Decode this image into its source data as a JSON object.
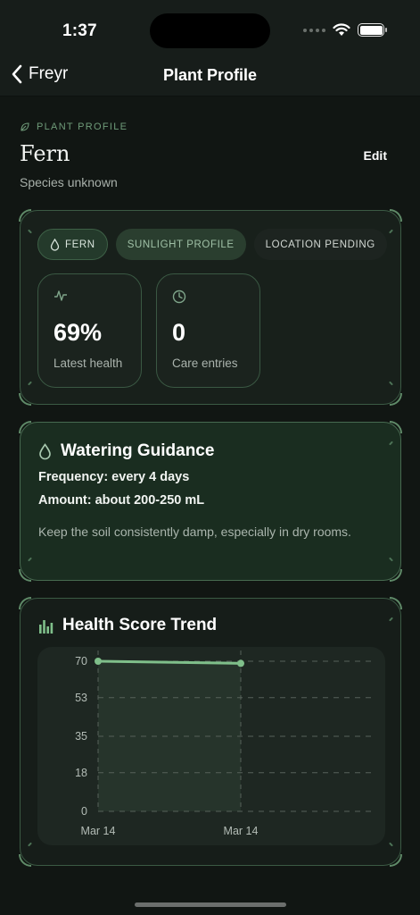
{
  "status_bar": {
    "time": "1:37"
  },
  "nav": {
    "back_label": "Freyr",
    "title": "Plant Profile"
  },
  "header": {
    "eyebrow": "PLANT PROFILE",
    "name": "Fern",
    "edit_label": "Edit",
    "species": "Species unknown"
  },
  "overview": {
    "chips": [
      "FERN",
      "SUNLIGHT PROFILE",
      "LOCATION PENDING"
    ],
    "stats": [
      {
        "value": "69%",
        "label": "Latest health",
        "icon": "pulse-icon"
      },
      {
        "value": "0",
        "label": "Care entries",
        "icon": "clock-icon"
      }
    ]
  },
  "watering": {
    "title": "Watering Guidance",
    "frequency": "Frequency: every 4 days",
    "amount": "Amount: about 200-250 mL",
    "note": "Keep the soil consistently damp, especially in dry rooms."
  },
  "trend": {
    "title": "Health Score Trend"
  },
  "colors": {
    "accent": "#7fbf8a",
    "background": "#111613",
    "card_border": "#3b5a44"
  },
  "chart_data": {
    "type": "line",
    "title": "Health Score Trend",
    "x": [
      "Mar 14",
      "Mar 14"
    ],
    "series": [
      {
        "values": [
          70,
          69
        ]
      }
    ],
    "y_ticks": [
      70,
      53,
      35,
      18,
      0
    ],
    "ylim": [
      0,
      70
    ],
    "grid": true,
    "xlabel": "",
    "ylabel": ""
  }
}
